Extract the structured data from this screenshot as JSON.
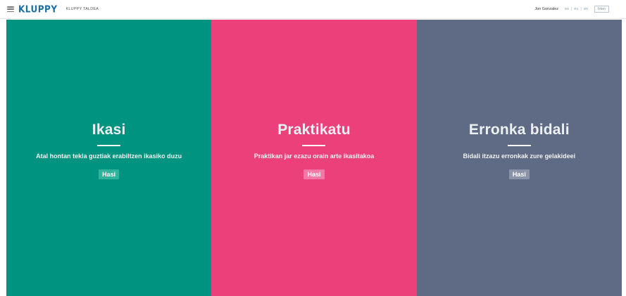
{
  "header": {
    "logo_text": "KLUPPY",
    "team_name": "KLUPPY TALDEA",
    "user_name": "Jon Gonzalez",
    "languages": [
      "es",
      "eu",
      "en"
    ],
    "exit_label": "Irten"
  },
  "panels": [
    {
      "title": "Ikasi",
      "description": "Atal hontan tekla guztiak erabiltzen ikasiko duzu",
      "button_label": "Hasi",
      "bg_color": "#009480",
      "button_color": "#2fb39a"
    },
    {
      "title": "Praktikatu",
      "description": "Praktikan jar ezazu orain arte ikasitakoa",
      "button_label": "Hasi",
      "bg_color": "#ec407a",
      "button_color": "#f47aa5"
    },
    {
      "title": "Erronka bidali",
      "description": "Bidali itzazu erronkak zure gelakideei",
      "button_label": "Hasi",
      "bg_color": "#5f6b84",
      "button_color": "#8a93a8"
    }
  ]
}
